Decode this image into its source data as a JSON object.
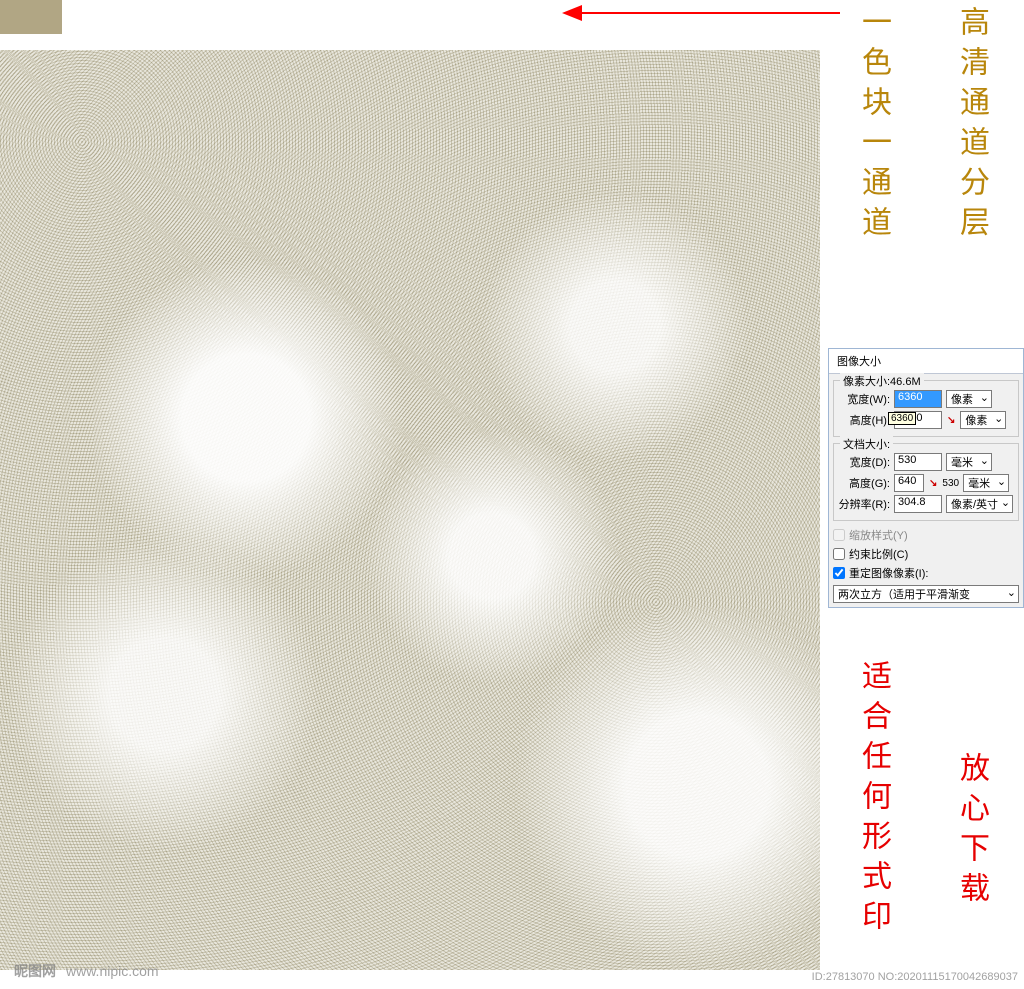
{
  "annotations": {
    "gold_left": "一色块一通道",
    "gold_right": "高清通道分层",
    "red_left": "适合任何形式印",
    "red_right": "放心下载"
  },
  "dialog": {
    "title": "图像大小",
    "pixel_group_label": "像素大小:46.6M",
    "width_px_label": "宽度(W):",
    "width_px_value": "6360",
    "height_px_label": "高度(H):",
    "height_px_value": "7680",
    "height_px_hint": "6360",
    "unit_px": "像素",
    "doc_group_label": "文档大小:",
    "doc_width_label": "宽度(D):",
    "doc_width_value": "530",
    "doc_height_label": "高度(G):",
    "doc_height_value": "640",
    "doc_height_hint": "530",
    "unit_mm": "毫米",
    "res_label": "分辨率(R):",
    "res_value": "304.8",
    "unit_res": "像素/英寸",
    "scale_styles": "缩放样式(Y)",
    "constrain": "约束比例(C)",
    "resample": "重定图像像素(I):",
    "method": "两次立方（适用于平滑渐变"
  },
  "watermark": {
    "site_cn": "昵图网",
    "site_url": "www.nipic.com",
    "meta": "ID:27813070 NO:20201115170042689037"
  }
}
